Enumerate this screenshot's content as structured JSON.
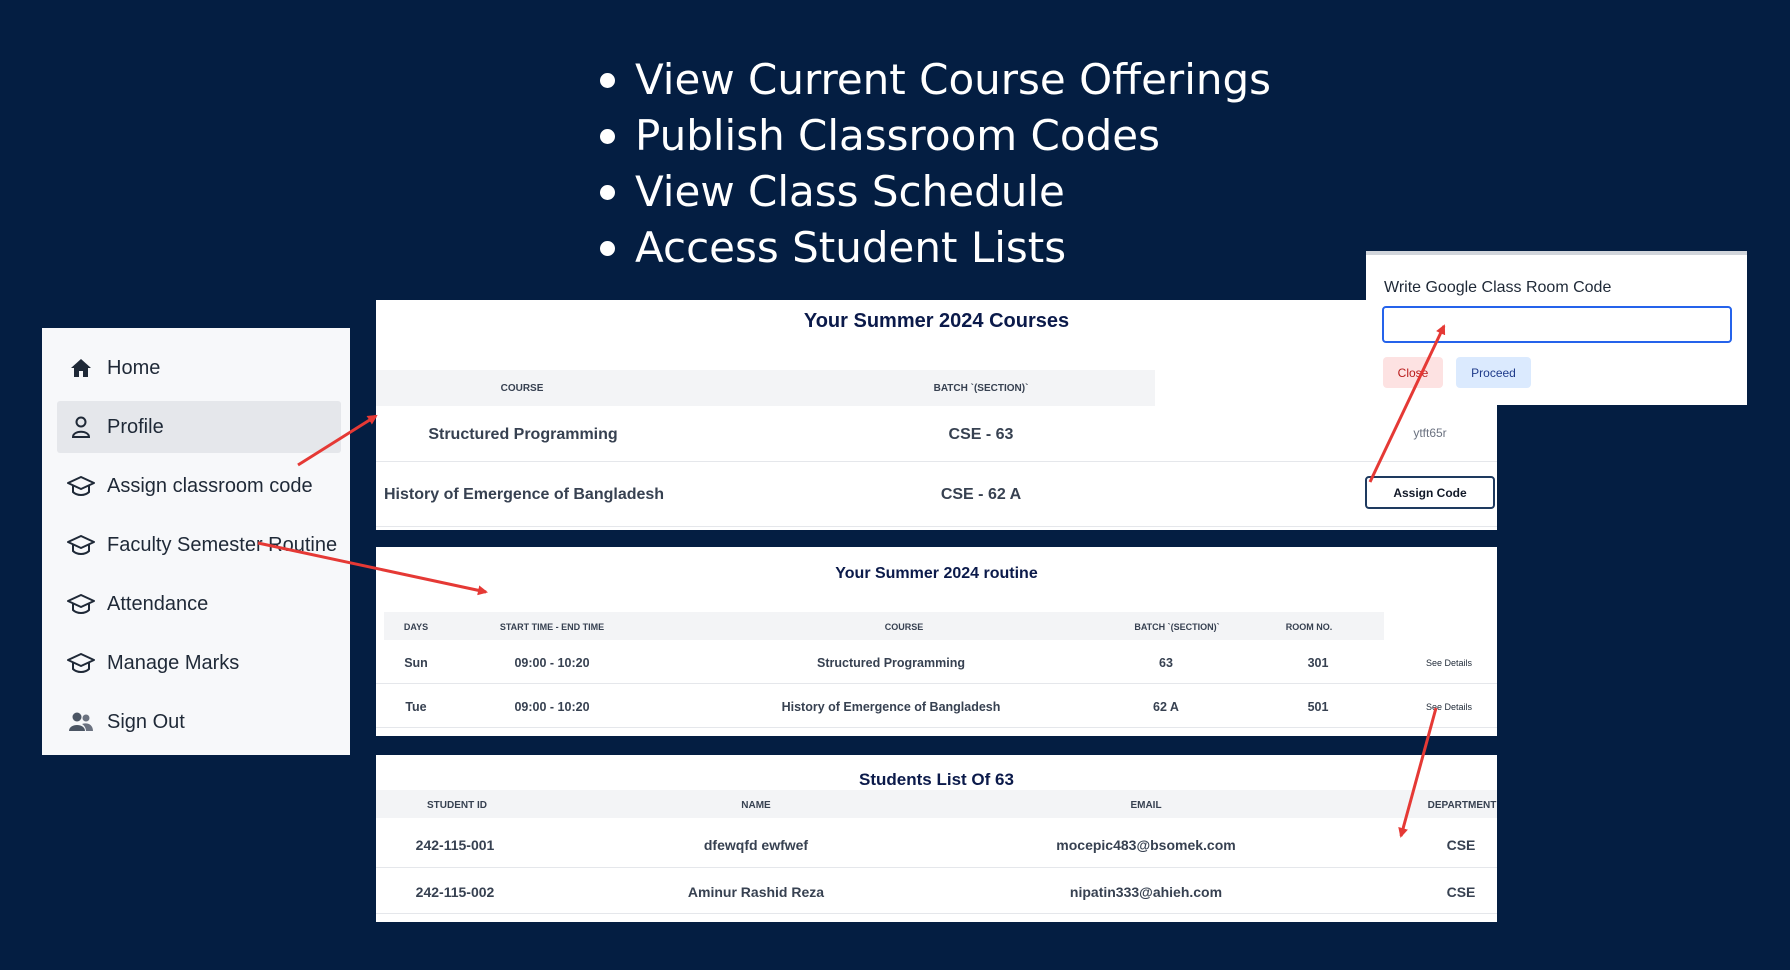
{
  "features": [
    "View Current Course Offerings",
    "Publish Classroom Codes",
    "View Class Schedule",
    "Access Student Lists"
  ],
  "sidebar": {
    "items": [
      {
        "label": "Home",
        "icon": "home-icon"
      },
      {
        "label": "Profile",
        "icon": "user-icon",
        "active": true
      },
      {
        "label": "Assign classroom code",
        "icon": "graduation-cap-icon"
      },
      {
        "label": "Faculty Semester Routine",
        "icon": "graduation-cap-icon"
      },
      {
        "label": "Attendance",
        "icon": "graduation-cap-icon"
      },
      {
        "label": "Manage Marks",
        "icon": "graduation-cap-icon"
      },
      {
        "label": "Sign Out",
        "icon": "users-icon"
      }
    ]
  },
  "courses": {
    "title": "Your Summer 2024 Courses",
    "headers": {
      "course": "COURSE",
      "batch": "BATCH `(SECTION)`"
    },
    "rows": [
      {
        "course": "Structured Programming",
        "batch": "CSE - 63",
        "code": "ytft65r"
      },
      {
        "course": "History of Emergence of Bangladesh",
        "batch": "CSE - 62 A",
        "action": "Assign Code"
      }
    ]
  },
  "routine": {
    "title": "Your Summer 2024 routine",
    "headers": {
      "days": "DAYS",
      "time": "START TIME - END TIME",
      "course": "COURSE",
      "batch": "BATCH `(SECTION)`",
      "room": "ROOM NO."
    },
    "rows": [
      {
        "day": "Sun",
        "time": "09:00 - 10:20",
        "course": "Structured Programming",
        "batch": "63",
        "room": "301",
        "link": "See Details"
      },
      {
        "day": "Tue",
        "time": "09:00 - 10:20",
        "course": "History of Emergence of Bangladesh",
        "batch": "62 A",
        "room": "501",
        "link": "See Details"
      }
    ]
  },
  "students": {
    "title": "Students List Of 63",
    "headers": {
      "id": "STUDENT ID",
      "name": "NAME",
      "email": "EMAIL",
      "dept": "DEPARTMENT"
    },
    "rows": [
      {
        "id": "242-115-001",
        "name": "dfewqfd ewfwef",
        "email": "mocepic483@bsomek.com",
        "dept": "CSE"
      },
      {
        "id": "242-115-002",
        "name": "Aminur Rashid Reza",
        "email": "nipatin333@ahieh.com",
        "dept": "CSE"
      }
    ]
  },
  "modal": {
    "label": "Write Google Class Room Code",
    "input_value": "",
    "close_label": "Close",
    "proceed_label": "Proceed"
  },
  "colors": {
    "background": "#041e42",
    "arrow": "#e53935",
    "title": "#0b1a4a",
    "input_focus": "#2563eb"
  }
}
